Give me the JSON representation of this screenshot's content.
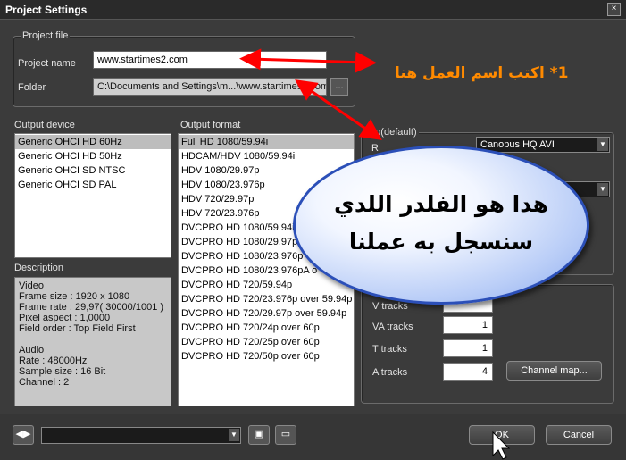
{
  "window": {
    "title": "Project Settings",
    "close": "×"
  },
  "project_file": {
    "legend": "Project file",
    "name_label": "Project name",
    "name_value": "www.startimes2.com",
    "folder_label": "Folder",
    "folder_value": "C:\\Documents and Settings\\m...\\www.startimes2.com",
    "browse_label": "..."
  },
  "output_device": {
    "label": "Output device",
    "items": [
      "Generic OHCI HD 60Hz",
      "Generic OHCI HD 50Hz",
      "Generic OHCI SD NTSC",
      "Generic OHCI SD PAL"
    ]
  },
  "output_format": {
    "label": "Output format",
    "items": [
      "Full HD 1080/59.94i",
      "HDCAM/HDV 1080/59.94i",
      "HDV 1080/29.97p",
      "HDV 1080/23.976p",
      "HDV 720/29.97p",
      "HDV 720/23.976p",
      "DVCPRO HD 1080/59.94i",
      "DVCPRO HD 1080/29.97p",
      "DVCPRO HD 1080/23.976p",
      "DVCPRO HD 1080/23.976pA o",
      "DVCPRO HD 720/59.94p",
      "DVCPRO HD 720/23.976p over 59.94p",
      "DVCPRO HD 720/29.97p over 59.94p",
      "DVCPRO HD 720/24p over 60p",
      "DVCPRO HD 720/25p over 60p",
      "DVCPRO HD 720/50p over 60p"
    ]
  },
  "description": {
    "label": "Description",
    "lines": [
      "Video",
      "  Frame size : 1920 x 1080",
      "  Frame rate : 29,97( 30000/1001 )",
      "  Pixel aspect : 1,0000",
      "  Field order : Top Field First",
      "",
      "Audio",
      "  Rate : 48000Hz",
      "  Sample size : 16 Bit",
      "  Channel : 2"
    ]
  },
  "setup": {
    "legend": "tup(default)",
    "row_label": "R",
    "codec_value": "Canopus HQ AVI"
  },
  "tracks": {
    "v_label": "V tracks",
    "va_label": "VA tracks",
    "va_value": "1",
    "t_label": "T tracks",
    "t_value": "1",
    "a_label": "A tracks",
    "a_value": "4",
    "channel_map_label": "Channel map..."
  },
  "footer": {
    "ok_label": "OK",
    "cancel_label": "Cancel"
  },
  "annotations": {
    "arrow_text": "1* اكتب اسم العمل هنا",
    "bubble_line1": "هدا هو الفلدر اللدي",
    "bubble_line2": "سنسجل به عملنا"
  },
  "colors": {
    "annotation": "#ff8a00",
    "arrow": "#ff0000",
    "bubble_border": "#2b4fb8"
  }
}
